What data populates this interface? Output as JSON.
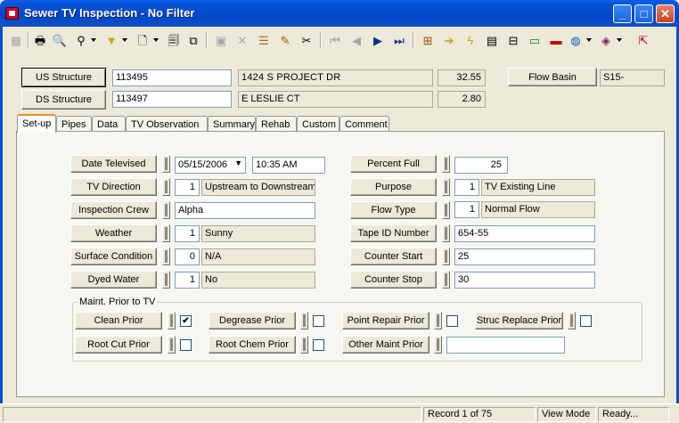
{
  "window": {
    "title": "Sewer TV Inspection - No Filter",
    "minimize": "_",
    "maximize": "□",
    "close": "✕"
  },
  "toolbar": {
    "icons": [
      "grid-icon",
      "print-icon",
      "print-preview-icon",
      "binoculars-icon",
      "filter-icon",
      "new-record-icon",
      "properties-icon",
      "copy-icon",
      "save-icon",
      "delete-icon",
      "stack-icon",
      "pencil-icon",
      "scissors-icon",
      "first-record-icon",
      "previous-record-icon",
      "next-record-icon",
      "last-record-icon",
      "goto-icon",
      "arrow-right-icon",
      "lightning-icon",
      "map-icon",
      "tree-icon",
      "monitor-icon",
      "camera-icon",
      "globe-icon",
      "books-icon",
      "exit-icon"
    ]
  },
  "header": {
    "us_structure_label": "US Structure",
    "us_structure_id": "113495",
    "us_address": "1424  S  PROJECT DR",
    "us_depth": "32.55",
    "ds_structure_label": "DS Structure",
    "ds_structure_id": "113497",
    "ds_address": "E LESLIE CT",
    "ds_depth": "2.80",
    "flow_basin_label": "Flow Basin",
    "flow_basin_value": "S15-"
  },
  "tabs": [
    "Set-up",
    "Pipes",
    "Data",
    "TV Observation",
    "Summary",
    "Rehab",
    "Custom",
    "Comment"
  ],
  "active_tab": "Set-up",
  "setup": {
    "date_televised": {
      "label": "Date Televised",
      "date": "05/15/2006",
      "time": "10:35 AM"
    },
    "tv_direction": {
      "label": "TV Direction",
      "code": "1",
      "desc": "Upstream to Downstream"
    },
    "inspection_crew": {
      "label": "Inspection Crew",
      "value": "Alpha"
    },
    "weather": {
      "label": "Weather",
      "code": "1",
      "desc": "Sunny"
    },
    "surface_condition": {
      "label": "Surface Condition",
      "code": "0",
      "desc": "N/A"
    },
    "dyed_water": {
      "label": "Dyed Water",
      "code": "1",
      "desc": "No"
    },
    "percent_full": {
      "label": "Percent Full",
      "value": "25"
    },
    "purpose": {
      "label": "Purpose",
      "code": "1",
      "desc": "TV Existing Line"
    },
    "flow_type": {
      "label": "Flow Type",
      "code": "1",
      "desc": "Normal Flow"
    },
    "tape_id": {
      "label": "Tape ID Number",
      "value": "654-55"
    },
    "counter_start": {
      "label": "Counter Start",
      "value": "25"
    },
    "counter_stop": {
      "label": "Counter Stop",
      "value": "30"
    }
  },
  "maint": {
    "group_label": "Maint. Prior to TV",
    "clean_prior": {
      "label": "Clean Prior",
      "checked": "✔"
    },
    "degrease_prior": {
      "label": "Degrease Prior",
      "checked": ""
    },
    "point_repair_prior": {
      "label": "Point Repair Prior",
      "checked": ""
    },
    "struc_replace_prior": {
      "label": "Struc Replace Prior",
      "checked": ""
    },
    "root_cut_prior": {
      "label": "Root Cut Prior",
      "checked": ""
    },
    "root_chem_prior": {
      "label": "Root Chem Prior",
      "checked": ""
    },
    "other_maint_prior": {
      "label": "Other Maint Prior",
      "value": ""
    }
  },
  "status": {
    "record": "Record 1 of 75",
    "mode": "View Mode",
    "state": "Ready..."
  }
}
